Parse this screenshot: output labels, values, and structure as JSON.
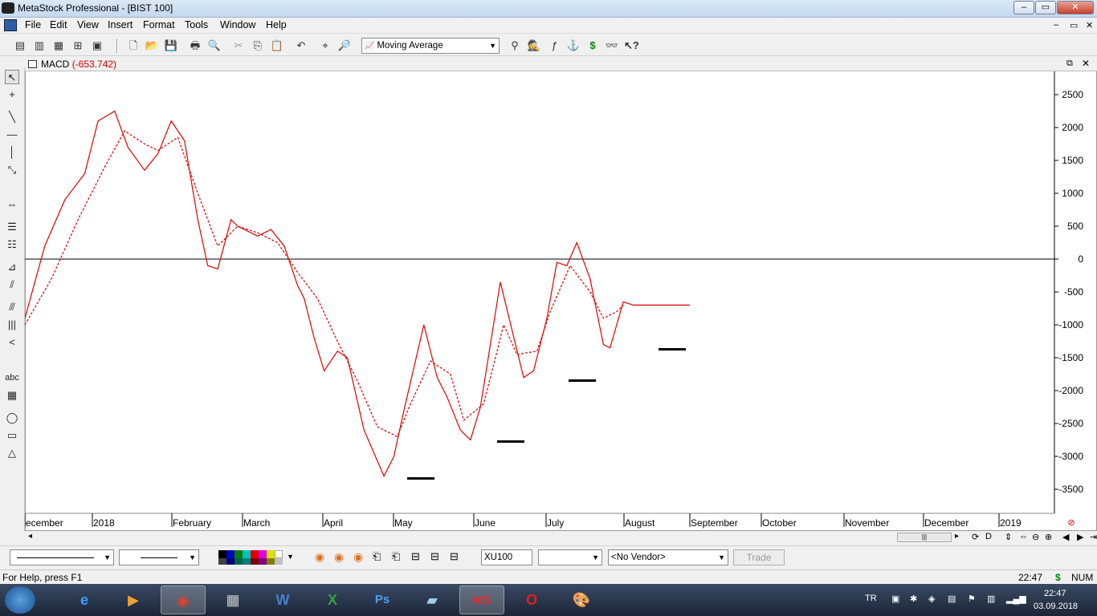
{
  "window": {
    "title": "MetaStock Professional - [BIST 100]"
  },
  "menu": [
    "File",
    "Edit",
    "View",
    "Insert",
    "Format",
    "Tools",
    "Window",
    "Help"
  ],
  "toolbar": {
    "indicator_select": "Moving Average"
  },
  "chart": {
    "caption_name": "MACD",
    "caption_value": "(-653.742)",
    "y_ticks": [
      "2500",
      "2000",
      "1500",
      "1000",
      "500",
      "0",
      "-500",
      "-1000",
      "-1500",
      "-2000",
      "-2500",
      "-3000",
      "-3500"
    ],
    "x_labels": [
      "ecember",
      "2018",
      "February",
      "March",
      "April",
      "May",
      "June",
      "July",
      "August",
      "September",
      "October",
      "November",
      "December",
      "2019"
    ]
  },
  "chart_data": {
    "type": "line",
    "ylim": [
      -3850,
      2800
    ],
    "ytick_values": [
      2500,
      2000,
      1500,
      1000,
      500,
      0,
      -500,
      -1000,
      -1500,
      -2000,
      -2500,
      -3000,
      -3500
    ],
    "series": [
      {
        "style": "solid",
        "color": "#e00000",
        "x": [
          0.0,
          0.03,
          0.06,
          0.09,
          0.11,
          0.135,
          0.155,
          0.18,
          0.2,
          0.22,
          0.24,
          0.26,
          0.275,
          0.29,
          0.31,
          0.32,
          0.35,
          0.37,
          0.39,
          0.41,
          0.42,
          0.435,
          0.45,
          0.47,
          0.485,
          0.51,
          0.54,
          0.555,
          0.57,
          0.6,
          0.62,
          0.635,
          0.655,
          0.67,
          0.685,
          0.715,
          0.75,
          0.765,
          0.785,
          0.8,
          0.815,
          0.83,
          0.85,
          0.87,
          0.88,
          0.89,
          0.9,
          0.915,
          0.93,
          0.95,
          0.965,
          0.985,
          1.0
        ],
        "y": [
          -900,
          200,
          900,
          1300,
          2100,
          2250,
          1700,
          1350,
          1600,
          2100,
          1800,
          600,
          -100,
          -150,
          600,
          500,
          350,
          450,
          200,
          -400,
          -600,
          -1200,
          -1700,
          -1400,
          -1500,
          -2600,
          -3300,
          -3000,
          -2300,
          -1000,
          -1800,
          -2100,
          -2600,
          -2750,
          -2250,
          -350,
          -1800,
          -1700,
          -900,
          -50,
          -100,
          250,
          -300,
          -1300,
          -1350,
          -1000,
          -650,
          -700,
          -700,
          -700,
          -700,
          -700,
          -700
        ]
      },
      {
        "style": "dashed",
        "color": "#e00000",
        "x": [
          0.0,
          0.04,
          0.08,
          0.12,
          0.15,
          0.18,
          0.2,
          0.23,
          0.26,
          0.29,
          0.32,
          0.35,
          0.38,
          0.41,
          0.44,
          0.47,
          0.5,
          0.53,
          0.56,
          0.58,
          0.61,
          0.64,
          0.66,
          0.69,
          0.72,
          0.74,
          0.77,
          0.79,
          0.82,
          0.85,
          0.87,
          0.89,
          0.9
        ],
        "y": [
          -1000,
          -300,
          600,
          1400,
          1950,
          1750,
          1650,
          1850,
          1000,
          200,
          500,
          400,
          250,
          -200,
          -600,
          -1250,
          -1850,
          -2550,
          -2700,
          -2200,
          -1550,
          -1750,
          -2450,
          -2200,
          -1000,
          -1450,
          -1400,
          -800,
          -100,
          -500,
          -900,
          -800,
          -700
        ]
      }
    ]
  },
  "bottom": {
    "symbol": "XU100",
    "vendor": "<No Vendor>",
    "trade": "Trade"
  },
  "status": {
    "help": "For Help, press F1",
    "time": "22:47",
    "currency": "$",
    "num": "NUM"
  },
  "taskbar": {
    "lang": "TR",
    "clock_time": "22:47",
    "clock_date": "03.09.2018"
  }
}
